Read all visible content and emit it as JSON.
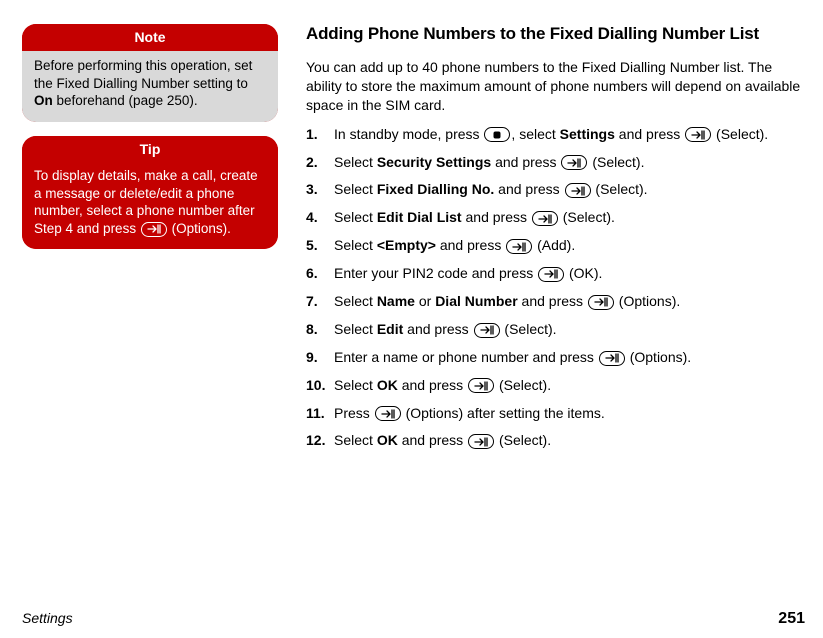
{
  "sidebar": {
    "note": {
      "title": "Note",
      "body_pre": "Before performing this operation, set the Fixed Dialling Number setting to ",
      "body_bold": "On",
      "body_post": " beforehand (page 250)."
    },
    "tip": {
      "title": "Tip",
      "body_pre": "To display details, make a call, create a message or delete/edit a phone number, select a phone number after Step 4 and press ",
      "body_post": " (Options)."
    }
  },
  "main": {
    "heading": "Adding Phone Numbers to the Fixed Dialling Number List",
    "intro": "You can add up to 40 phone numbers to the Fixed Dialling Number list. The ability to store the maximum amount of phone numbers will depend on available space in the SIM card.",
    "steps": [
      {
        "n": "1.",
        "pre": "In standby mode, press ",
        "key1": "center",
        "mid": ", select ",
        "bold": "Settings",
        "aft": " and press ",
        "key2": "soft",
        "tail": " (Select)."
      },
      {
        "n": "2.",
        "pre": "Select ",
        "bold": "Security Settings",
        "aft": " and press ",
        "key2": "soft",
        "tail": " (Select)."
      },
      {
        "n": "3.",
        "pre": "Select ",
        "bold": "Fixed Dialling No.",
        "aft": " and press ",
        "key2": "soft",
        "tail": " (Select)."
      },
      {
        "n": "4.",
        "pre": "Select ",
        "bold": "Edit Dial List",
        "aft": " and press ",
        "key2": "soft",
        "tail": " (Select)."
      },
      {
        "n": "5.",
        "pre": "Select ",
        "bold": "<Empty>",
        "aft": " and press ",
        "key2": "soft",
        "tail": " (Add)."
      },
      {
        "n": "6.",
        "pre": "Enter your PIN2 code and press ",
        "key2": "soft",
        "tail": " (OK)."
      },
      {
        "n": "7.",
        "pre": "Select ",
        "bold": "Name",
        "mid": " or ",
        "bold2": "Dial Number",
        "aft": " and press ",
        "key2": "soft",
        "tail": " (Options)."
      },
      {
        "n": "8.",
        "pre": "Select ",
        "bold": "Edit",
        "aft": " and press ",
        "key2": "soft",
        "tail": " (Select)."
      },
      {
        "n": "9.",
        "pre": "Enter a name or phone number and press ",
        "key2": "soft",
        "tail": " (Options)."
      },
      {
        "n": "10.",
        "pre": "Select ",
        "bold": "OK",
        "aft": " and press ",
        "key2": "soft",
        "tail": " (Select)."
      },
      {
        "n": "11.",
        "pre": "Press ",
        "key2": "soft",
        "tail": " (Options) after setting the items."
      },
      {
        "n": "12.",
        "pre": "Select ",
        "bold": "OK",
        "aft": " and press ",
        "key2": "soft",
        "tail": " (Select)."
      }
    ]
  },
  "footer": {
    "section": "Settings",
    "page": "251"
  }
}
